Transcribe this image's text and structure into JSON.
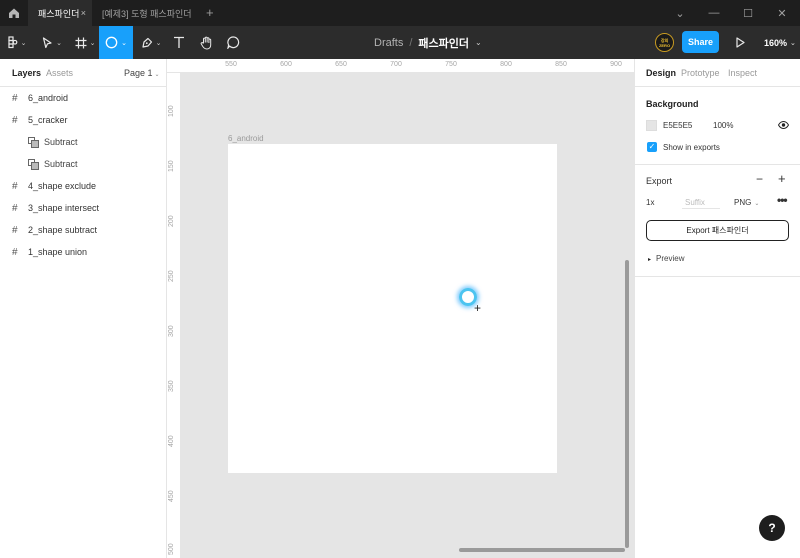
{
  "titlebar": {
    "tabs": [
      {
        "label": "패스파인더",
        "close": "×"
      },
      {
        "label": "[예제3] 도형 패스파인더"
      }
    ],
    "new_tab": "+",
    "window_controls": {
      "menu": "⌄",
      "minimize": "—",
      "maximize": "☐",
      "close": "✕"
    }
  },
  "toolbar": {
    "tools": [
      "figma-menu-icon",
      "move-tool-icon",
      "frame-tool-icon",
      "ellipse-tool-icon",
      "pen-tool-icon",
      "text-tool-icon",
      "hand-tool-icon",
      "comment-tool-icon"
    ],
    "active_tool": "ellipse-tool-icon",
    "caret": "⌄",
    "breadcrumb": {
      "project": "Drafts",
      "separator": "/",
      "file": "패스파인더",
      "caret": "⌄"
    },
    "avatar_text": "강의 ZERO",
    "share_label": "Share",
    "zoom_label": "160%"
  },
  "layers_panel": {
    "tabs": {
      "layers": "Layers",
      "assets": "Assets",
      "page": "Page 1"
    },
    "hash": "#",
    "items": [
      {
        "label": "6_android",
        "type": "frame"
      },
      {
        "label": "5_cracker",
        "type": "frame"
      },
      {
        "label": "Subtract",
        "type": "boolean"
      },
      {
        "label": "Subtract",
        "type": "boolean"
      },
      {
        "label": "4_shape exclude",
        "type": "frame"
      },
      {
        "label": "3_shape intersect",
        "type": "frame"
      },
      {
        "label": "2_shape subtract",
        "type": "frame"
      },
      {
        "label": "1_shape union",
        "type": "frame"
      }
    ]
  },
  "rulers": {
    "top": [
      "550",
      "600",
      "650",
      "700",
      "750",
      "800",
      "850",
      "900"
    ],
    "left": [
      "100",
      "150",
      "200",
      "250",
      "300",
      "350",
      "400",
      "450",
      "500"
    ]
  },
  "canvas": {
    "frame_label": "6_android",
    "background": "#E5E5E5",
    "cursor_glyph": "+"
  },
  "design_panel": {
    "tabs": {
      "design": "Design",
      "prototype": "Prototype",
      "inspect": "Inspect"
    },
    "background": {
      "title": "Background",
      "hex": "E5E5E5",
      "opacity": "100%",
      "show_in_exports": "Show in exports",
      "checked": true,
      "check_glyph": "✓"
    },
    "export": {
      "title": "Export",
      "minus": "−",
      "plus": "+",
      "scale": "1x",
      "suffix_placeholder": "Suffix",
      "format": "PNG",
      "more": "•••",
      "export_button": "Export 패스파인더",
      "preview": "Preview",
      "preview_glyph": "▸"
    }
  },
  "help": "?",
  "colors": {
    "accent": "#18A0FB",
    "toolbar": "#2C2C2C",
    "canvas": "#E5E5E5"
  }
}
